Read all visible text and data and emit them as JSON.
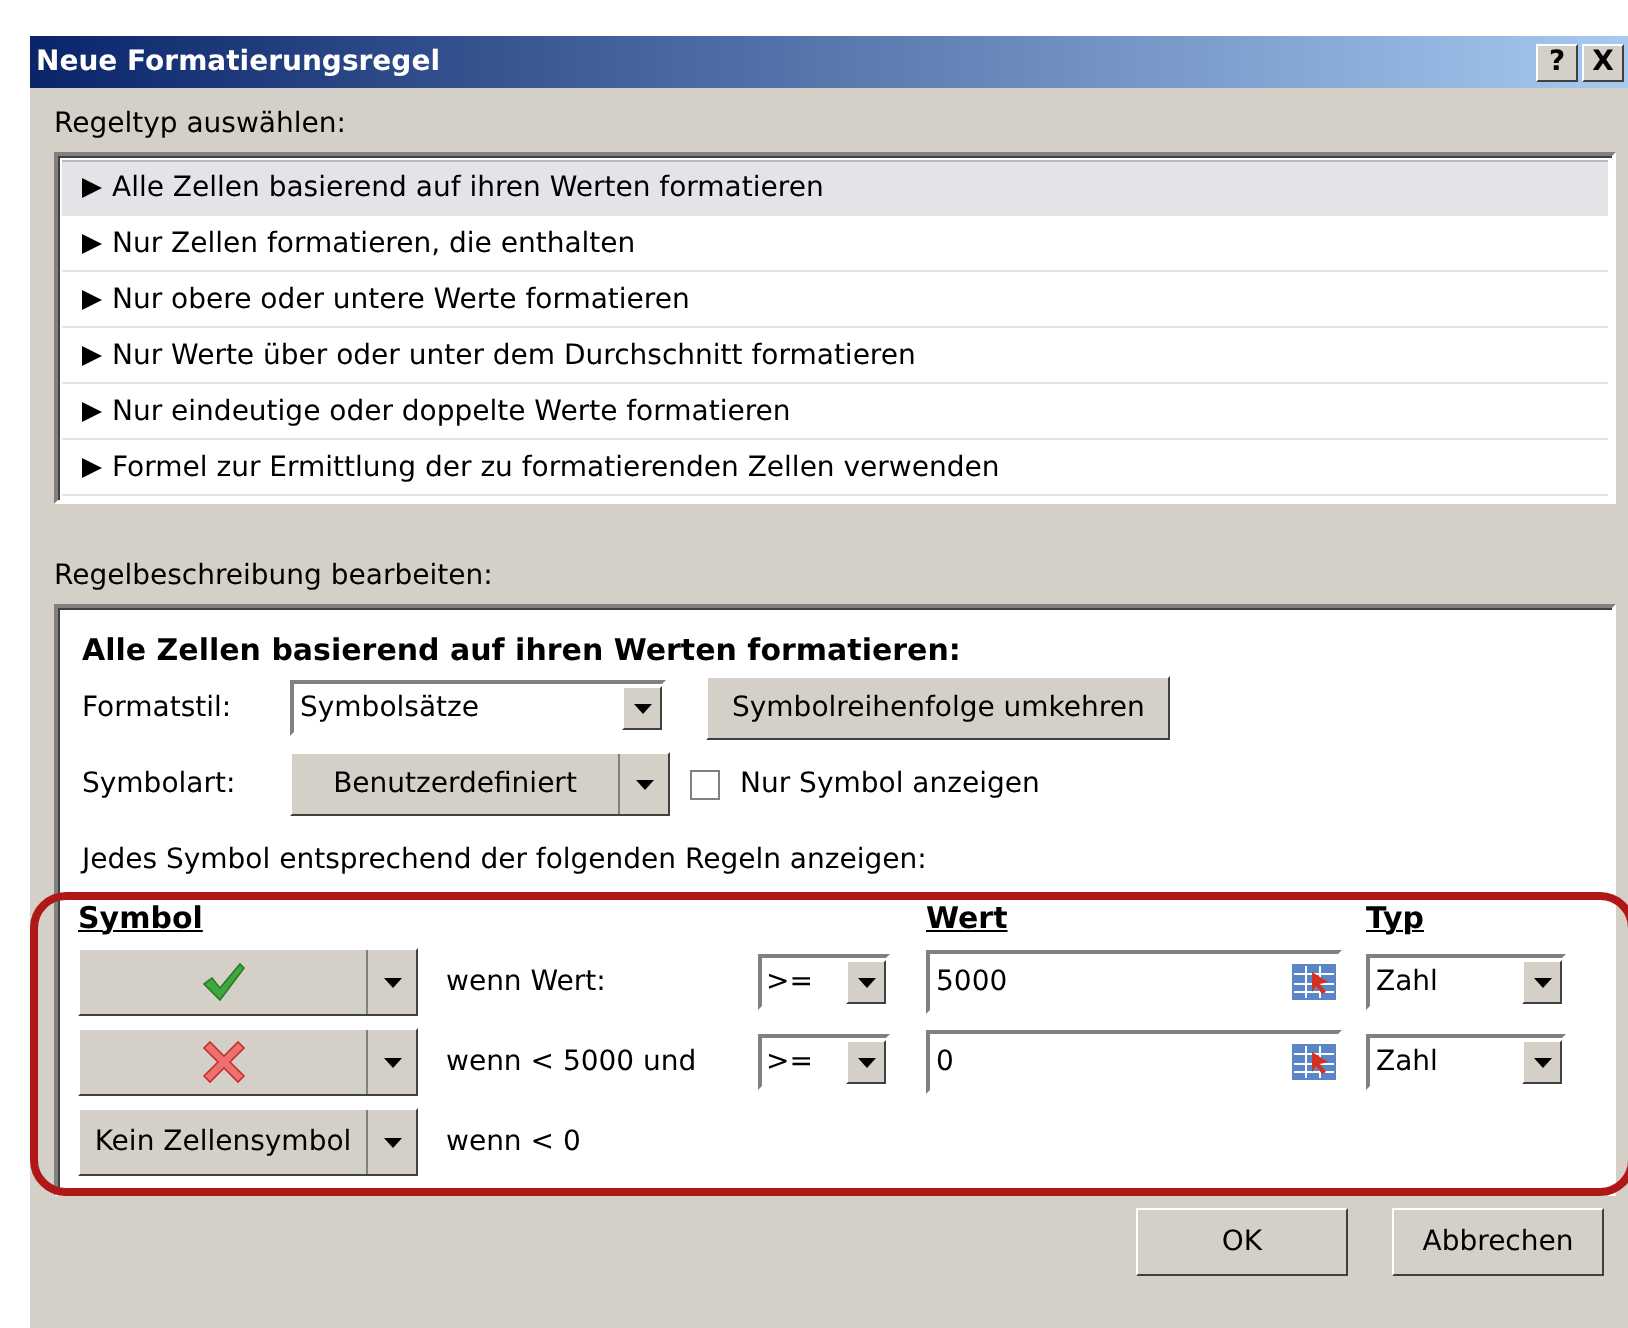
{
  "window": {
    "title": "Neue Formatierungsregel",
    "help": "?",
    "close": "X"
  },
  "rule_type": {
    "label": "Regeltyp auswählen:",
    "items": [
      {
        "text": "Alle Zellen basierend auf ihren Werten formatieren",
        "selected": true
      },
      {
        "text": "Nur Zellen formatieren, die enthalten",
        "selected": false
      },
      {
        "text": "Nur obere oder untere Werte formatieren",
        "selected": false
      },
      {
        "text": "Nur Werte über oder unter dem Durchschnitt formatieren",
        "selected": false
      },
      {
        "text": "Nur eindeutige oder doppelte Werte formatieren",
        "selected": false
      },
      {
        "text": "Formel zur Ermittlung der zu formatierenden Zellen verwenden",
        "selected": false
      }
    ]
  },
  "description": {
    "label": "Regelbeschreibung bearbeiten:",
    "heading": "Alle Zellen basierend auf ihren Werten formatieren:",
    "format_style": {
      "label": "Formatstil:",
      "value": "Symbolsätze"
    },
    "reverse_button": "Symbolreihenfolge umkehren",
    "symbol_type": {
      "label": "Symbolart:",
      "value": "Benutzerdefiniert"
    },
    "only_symbol": {
      "label": "Nur Symbol anzeigen",
      "checked": false
    },
    "instruction": "Jedes Symbol entsprechend der folgenden Regeln anzeigen:",
    "columns": [
      "Symbol",
      "Wert",
      "Typ"
    ],
    "rules": [
      {
        "kind": "check",
        "condition": "wenn Wert:",
        "operator": ">=",
        "value": "5000",
        "type": "Zahl"
      },
      {
        "kind": "cross",
        "condition": "wenn < 5000 und",
        "operator": ">=",
        "value": "0",
        "type": "Zahl"
      },
      {
        "kind": "text",
        "symbol": "Kein Zellensymbol",
        "condition": "wenn < 0"
      }
    ]
  },
  "buttons": [
    "OK",
    "Abbrechen"
  ]
}
